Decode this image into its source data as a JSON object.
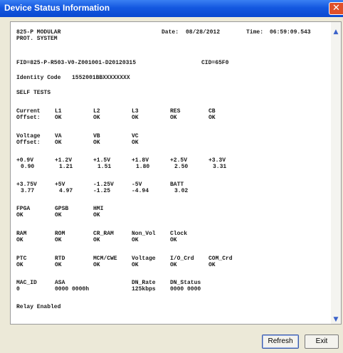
{
  "window": {
    "title": "Device Status Information",
    "close_glyph": "✕"
  },
  "header": {
    "model": "825-P MODULAR",
    "subtitle": "PROT. SYSTEM",
    "date_label": "Date:",
    "date": "08/28/2012",
    "time_label": "Time:",
    "time": "06:59:09.543",
    "fid": "FID=825-P-R503-V0-Z001001-D20120315",
    "cid": "CID=65F0",
    "identity_label": "Identity Code",
    "identity_value": "1552001BBXXXXXXXX",
    "self_tests": "SELF TESTS"
  },
  "current_offset": {
    "label1": "Current",
    "label2": "Offset:",
    "cols": [
      "L1",
      "L2",
      "L3",
      "RES",
      "CB"
    ],
    "vals": [
      "OK",
      "OK",
      "OK",
      "OK",
      "OK"
    ]
  },
  "voltage_offset": {
    "label1": "Voltage",
    "label2": "Offset:",
    "cols": [
      "VA",
      "VB",
      "VC"
    ],
    "vals": [
      "OK",
      "OK",
      "OK"
    ]
  },
  "rails1": {
    "cols": [
      "+0.9V",
      "+1.2V",
      "+1.5V",
      "+1.8V",
      "+2.5V",
      "+3.3V"
    ],
    "vals": [
      "0.90",
      "1.21",
      "1.51",
      "1.80",
      "2.50",
      "3.31"
    ]
  },
  "rails2": {
    "cols": [
      "+3.75V",
      "+5V",
      "-1.25V",
      "-5V",
      "BATT"
    ],
    "vals": [
      "3.77",
      "4.97",
      "-1.25",
      "-4.94",
      "3.02"
    ]
  },
  "chips": {
    "cols": [
      "FPGA",
      "GPSB",
      "HMI"
    ],
    "vals": [
      "OK",
      "OK",
      "OK"
    ]
  },
  "memory": {
    "cols": [
      "RAM",
      "ROM",
      "CR_RAM",
      "Non_Vol",
      "Clock"
    ],
    "vals": [
      "OK",
      "OK",
      "OK",
      "OK",
      "OK"
    ]
  },
  "cards": {
    "cols": [
      "PTC",
      "RTD",
      "MCM/CWE",
      "Voltage",
      "I/O_Crd",
      "COM_Crd"
    ],
    "vals": [
      "OK",
      "OK",
      "OK",
      "OK",
      "OK",
      "OK"
    ]
  },
  "network": {
    "cols": [
      "MAC_ID",
      "ASA",
      "DN_Rate",
      "DN_Status"
    ],
    "vals": [
      "0",
      "0000 0000h",
      "125kbps",
      "0000 0000"
    ]
  },
  "relay": "Relay Enabled",
  "buttons": {
    "refresh": "Refresh",
    "exit": "Exit"
  },
  "scrollbar": {
    "up_glyph": "▲",
    "down_glyph": "▼"
  }
}
